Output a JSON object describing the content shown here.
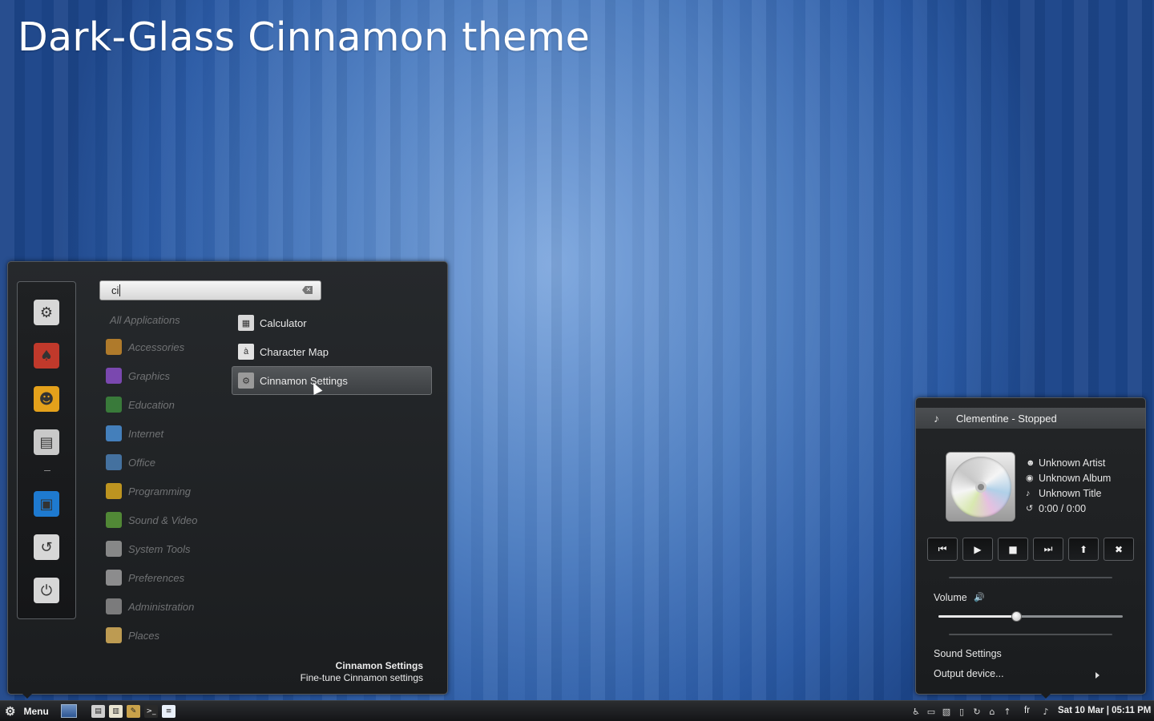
{
  "desktop": {
    "title": "Dark-Glass Cinnamon theme"
  },
  "menu": {
    "favorites": [
      {
        "name": "settings-icon",
        "glyph": "⚙",
        "bg": "#d7d7d7"
      },
      {
        "name": "app-icon",
        "glyph": "♠",
        "bg": "#c0392b"
      },
      {
        "name": "users-icon",
        "glyph": "☻",
        "bg": "#e4a11b"
      },
      {
        "name": "files-icon",
        "glyph": "▤",
        "bg": "#c9c9c9"
      },
      {
        "name": "lock-screen-icon",
        "glyph": "▣",
        "bg": "#1e7ad0"
      },
      {
        "name": "logout-icon",
        "glyph": "↺",
        "bg": "#d7d7d7"
      },
      {
        "name": "shutdown-icon",
        "glyph": "⏻",
        "bg": "#d7d7d7"
      }
    ],
    "search": {
      "value": "ci"
    },
    "categories": [
      {
        "label": "All Applications",
        "icon": ""
      },
      {
        "label": "Accessories",
        "icon": "#c88a2c"
      },
      {
        "label": "Graphics",
        "icon": "#8a4fc7"
      },
      {
        "label": "Education",
        "icon": "#3d8a3d"
      },
      {
        "label": "Internet",
        "icon": "#4a8fd6"
      },
      {
        "label": "Office",
        "icon": "#4a7fb5"
      },
      {
        "label": "Programming",
        "icon": "#d9a820"
      },
      {
        "label": "Sound & Video",
        "icon": "#5a9a3a"
      },
      {
        "label": "System Tools",
        "icon": "#9a9a9a"
      },
      {
        "label": "Preferences",
        "icon": "#a0a0a0"
      },
      {
        "label": "Administration",
        "icon": "#8c8c8c"
      },
      {
        "label": "Places",
        "icon": "#d9b25a"
      }
    ],
    "apps": [
      {
        "label": "Calculator",
        "glyph": "▦",
        "bg": "#d8d8d8",
        "selected": false
      },
      {
        "label": "Character Map",
        "glyph": "à",
        "bg": "#e2e2e2",
        "selected": false
      },
      {
        "label": "Cinnamon Settings",
        "glyph": "⚙",
        "bg": "#9a9a9a",
        "selected": true
      }
    ],
    "description": {
      "title": "Cinnamon Settings",
      "subtitle": "Fine-tune Cinnamon settings"
    }
  },
  "sound": {
    "player": "Clementine - Stopped",
    "artist": "Unknown Artist",
    "album": "Unknown Album",
    "title": "Unknown Title",
    "time": "0:00 / 0:00",
    "controls": [
      {
        "name": "previous-button",
        "glyph": "⏮"
      },
      {
        "name": "play-button",
        "glyph": "▶"
      },
      {
        "name": "stop-button",
        "glyph": "■"
      },
      {
        "name": "next-button",
        "glyph": "⏭"
      },
      {
        "name": "eject-button",
        "glyph": "⬆"
      },
      {
        "name": "close-player-button",
        "glyph": "✖"
      }
    ],
    "volume_label": "Volume",
    "volume_level": 0.42,
    "settings_label": "Sound Settings",
    "output_label": "Output device..."
  },
  "panel": {
    "menu_label": "Menu",
    "launchers": [
      {
        "name": "file-manager-launcher-icon",
        "glyph": "▤",
        "bg": "#cfcfcf"
      },
      {
        "name": "book-launcher-icon",
        "glyph": "▥",
        "bg": "#e8e3d0"
      },
      {
        "name": "tool-launcher-icon",
        "glyph": "✎",
        "bg": "#c9a24a"
      },
      {
        "name": "terminal-launcher-icon",
        "glyph": ">_",
        "bg": "#2a2a2a"
      },
      {
        "name": "text-editor-launcher-icon",
        "glyph": "≡",
        "bg": "#e9f0fa"
      }
    ],
    "tray": [
      {
        "name": "accessibility-icon",
        "glyph": "♿"
      },
      {
        "name": "display-icon",
        "glyph": "▭"
      },
      {
        "name": "network-icon",
        "glyph": "▧"
      },
      {
        "name": "trash-icon",
        "glyph": "▯"
      },
      {
        "name": "refresh-icon",
        "glyph": "↻"
      },
      {
        "name": "home-icon",
        "glyph": "⌂"
      },
      {
        "name": "upload-icon",
        "glyph": "↑"
      }
    ],
    "keyboard": "fr",
    "clock": "Sat 10 Mar | 05:11 PM"
  }
}
